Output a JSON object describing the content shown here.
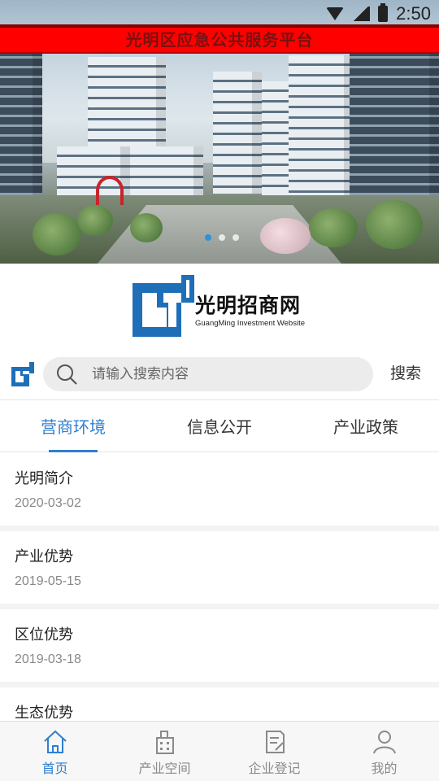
{
  "status_bar": {
    "time": "2:50"
  },
  "app_title": "光明区应急公共服务平台",
  "banner": {
    "slides": 3,
    "active_slide": 1
  },
  "logo": {
    "cn": "光明招商网",
    "en": "GuangMing Investment Website"
  },
  "search": {
    "placeholder": "请输入搜索内容",
    "button": "搜索"
  },
  "tabs": [
    {
      "label": "营商环境",
      "active": true
    },
    {
      "label": "信息公开",
      "active": false
    },
    {
      "label": "产业政策",
      "active": false
    }
  ],
  "list": [
    {
      "title": "光明简介",
      "date": "2020-03-02"
    },
    {
      "title": "产业优势",
      "date": "2019-05-15"
    },
    {
      "title": "区位优势",
      "date": "2019-03-18"
    },
    {
      "title": "生态优势",
      "date": ""
    }
  ],
  "bottom_nav": [
    {
      "label": "首页",
      "icon": "home-icon",
      "active": true
    },
    {
      "label": "产业空间",
      "icon": "building-icon",
      "active": false
    },
    {
      "label": "企业登记",
      "icon": "document-edit-icon",
      "active": false
    },
    {
      "label": "我的",
      "icon": "user-icon",
      "active": false
    }
  ],
  "colors": {
    "accent": "#2f7fcf",
    "title_bar": "#ff0000",
    "logo_blue": "#1f6fb8"
  }
}
